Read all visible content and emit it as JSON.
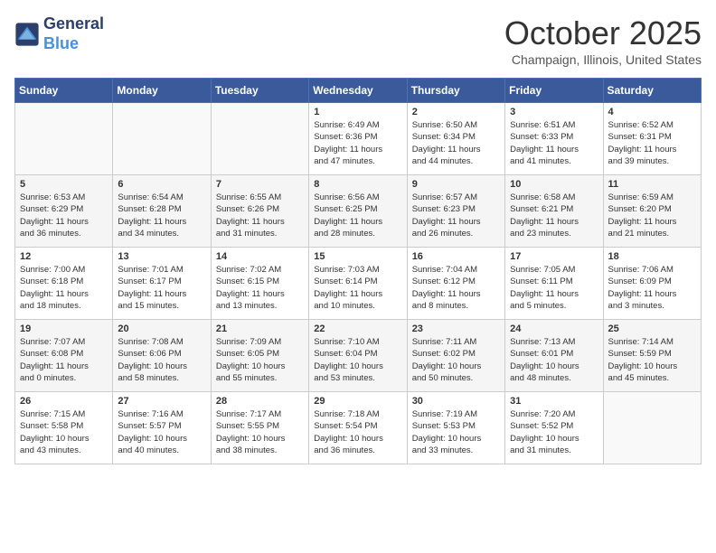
{
  "header": {
    "logo_line1": "General",
    "logo_line2": "Blue",
    "month": "October 2025",
    "location": "Champaign, Illinois, United States"
  },
  "days_of_week": [
    "Sunday",
    "Monday",
    "Tuesday",
    "Wednesday",
    "Thursday",
    "Friday",
    "Saturday"
  ],
  "weeks": [
    [
      {
        "day": "",
        "info": ""
      },
      {
        "day": "",
        "info": ""
      },
      {
        "day": "",
        "info": ""
      },
      {
        "day": "1",
        "info": "Sunrise: 6:49 AM\nSunset: 6:36 PM\nDaylight: 11 hours\nand 47 minutes."
      },
      {
        "day": "2",
        "info": "Sunrise: 6:50 AM\nSunset: 6:34 PM\nDaylight: 11 hours\nand 44 minutes."
      },
      {
        "day": "3",
        "info": "Sunrise: 6:51 AM\nSunset: 6:33 PM\nDaylight: 11 hours\nand 41 minutes."
      },
      {
        "day": "4",
        "info": "Sunrise: 6:52 AM\nSunset: 6:31 PM\nDaylight: 11 hours\nand 39 minutes."
      }
    ],
    [
      {
        "day": "5",
        "info": "Sunrise: 6:53 AM\nSunset: 6:29 PM\nDaylight: 11 hours\nand 36 minutes."
      },
      {
        "day": "6",
        "info": "Sunrise: 6:54 AM\nSunset: 6:28 PM\nDaylight: 11 hours\nand 34 minutes."
      },
      {
        "day": "7",
        "info": "Sunrise: 6:55 AM\nSunset: 6:26 PM\nDaylight: 11 hours\nand 31 minutes."
      },
      {
        "day": "8",
        "info": "Sunrise: 6:56 AM\nSunset: 6:25 PM\nDaylight: 11 hours\nand 28 minutes."
      },
      {
        "day": "9",
        "info": "Sunrise: 6:57 AM\nSunset: 6:23 PM\nDaylight: 11 hours\nand 26 minutes."
      },
      {
        "day": "10",
        "info": "Sunrise: 6:58 AM\nSunset: 6:21 PM\nDaylight: 11 hours\nand 23 minutes."
      },
      {
        "day": "11",
        "info": "Sunrise: 6:59 AM\nSunset: 6:20 PM\nDaylight: 11 hours\nand 21 minutes."
      }
    ],
    [
      {
        "day": "12",
        "info": "Sunrise: 7:00 AM\nSunset: 6:18 PM\nDaylight: 11 hours\nand 18 minutes."
      },
      {
        "day": "13",
        "info": "Sunrise: 7:01 AM\nSunset: 6:17 PM\nDaylight: 11 hours\nand 15 minutes."
      },
      {
        "day": "14",
        "info": "Sunrise: 7:02 AM\nSunset: 6:15 PM\nDaylight: 11 hours\nand 13 minutes."
      },
      {
        "day": "15",
        "info": "Sunrise: 7:03 AM\nSunset: 6:14 PM\nDaylight: 11 hours\nand 10 minutes."
      },
      {
        "day": "16",
        "info": "Sunrise: 7:04 AM\nSunset: 6:12 PM\nDaylight: 11 hours\nand 8 minutes."
      },
      {
        "day": "17",
        "info": "Sunrise: 7:05 AM\nSunset: 6:11 PM\nDaylight: 11 hours\nand 5 minutes."
      },
      {
        "day": "18",
        "info": "Sunrise: 7:06 AM\nSunset: 6:09 PM\nDaylight: 11 hours\nand 3 minutes."
      }
    ],
    [
      {
        "day": "19",
        "info": "Sunrise: 7:07 AM\nSunset: 6:08 PM\nDaylight: 11 hours\nand 0 minutes."
      },
      {
        "day": "20",
        "info": "Sunrise: 7:08 AM\nSunset: 6:06 PM\nDaylight: 10 hours\nand 58 minutes."
      },
      {
        "day": "21",
        "info": "Sunrise: 7:09 AM\nSunset: 6:05 PM\nDaylight: 10 hours\nand 55 minutes."
      },
      {
        "day": "22",
        "info": "Sunrise: 7:10 AM\nSunset: 6:04 PM\nDaylight: 10 hours\nand 53 minutes."
      },
      {
        "day": "23",
        "info": "Sunrise: 7:11 AM\nSunset: 6:02 PM\nDaylight: 10 hours\nand 50 minutes."
      },
      {
        "day": "24",
        "info": "Sunrise: 7:13 AM\nSunset: 6:01 PM\nDaylight: 10 hours\nand 48 minutes."
      },
      {
        "day": "25",
        "info": "Sunrise: 7:14 AM\nSunset: 5:59 PM\nDaylight: 10 hours\nand 45 minutes."
      }
    ],
    [
      {
        "day": "26",
        "info": "Sunrise: 7:15 AM\nSunset: 5:58 PM\nDaylight: 10 hours\nand 43 minutes."
      },
      {
        "day": "27",
        "info": "Sunrise: 7:16 AM\nSunset: 5:57 PM\nDaylight: 10 hours\nand 40 minutes."
      },
      {
        "day": "28",
        "info": "Sunrise: 7:17 AM\nSunset: 5:55 PM\nDaylight: 10 hours\nand 38 minutes."
      },
      {
        "day": "29",
        "info": "Sunrise: 7:18 AM\nSunset: 5:54 PM\nDaylight: 10 hours\nand 36 minutes."
      },
      {
        "day": "30",
        "info": "Sunrise: 7:19 AM\nSunset: 5:53 PM\nDaylight: 10 hours\nand 33 minutes."
      },
      {
        "day": "31",
        "info": "Sunrise: 7:20 AM\nSunset: 5:52 PM\nDaylight: 10 hours\nand 31 minutes."
      },
      {
        "day": "",
        "info": ""
      }
    ]
  ]
}
